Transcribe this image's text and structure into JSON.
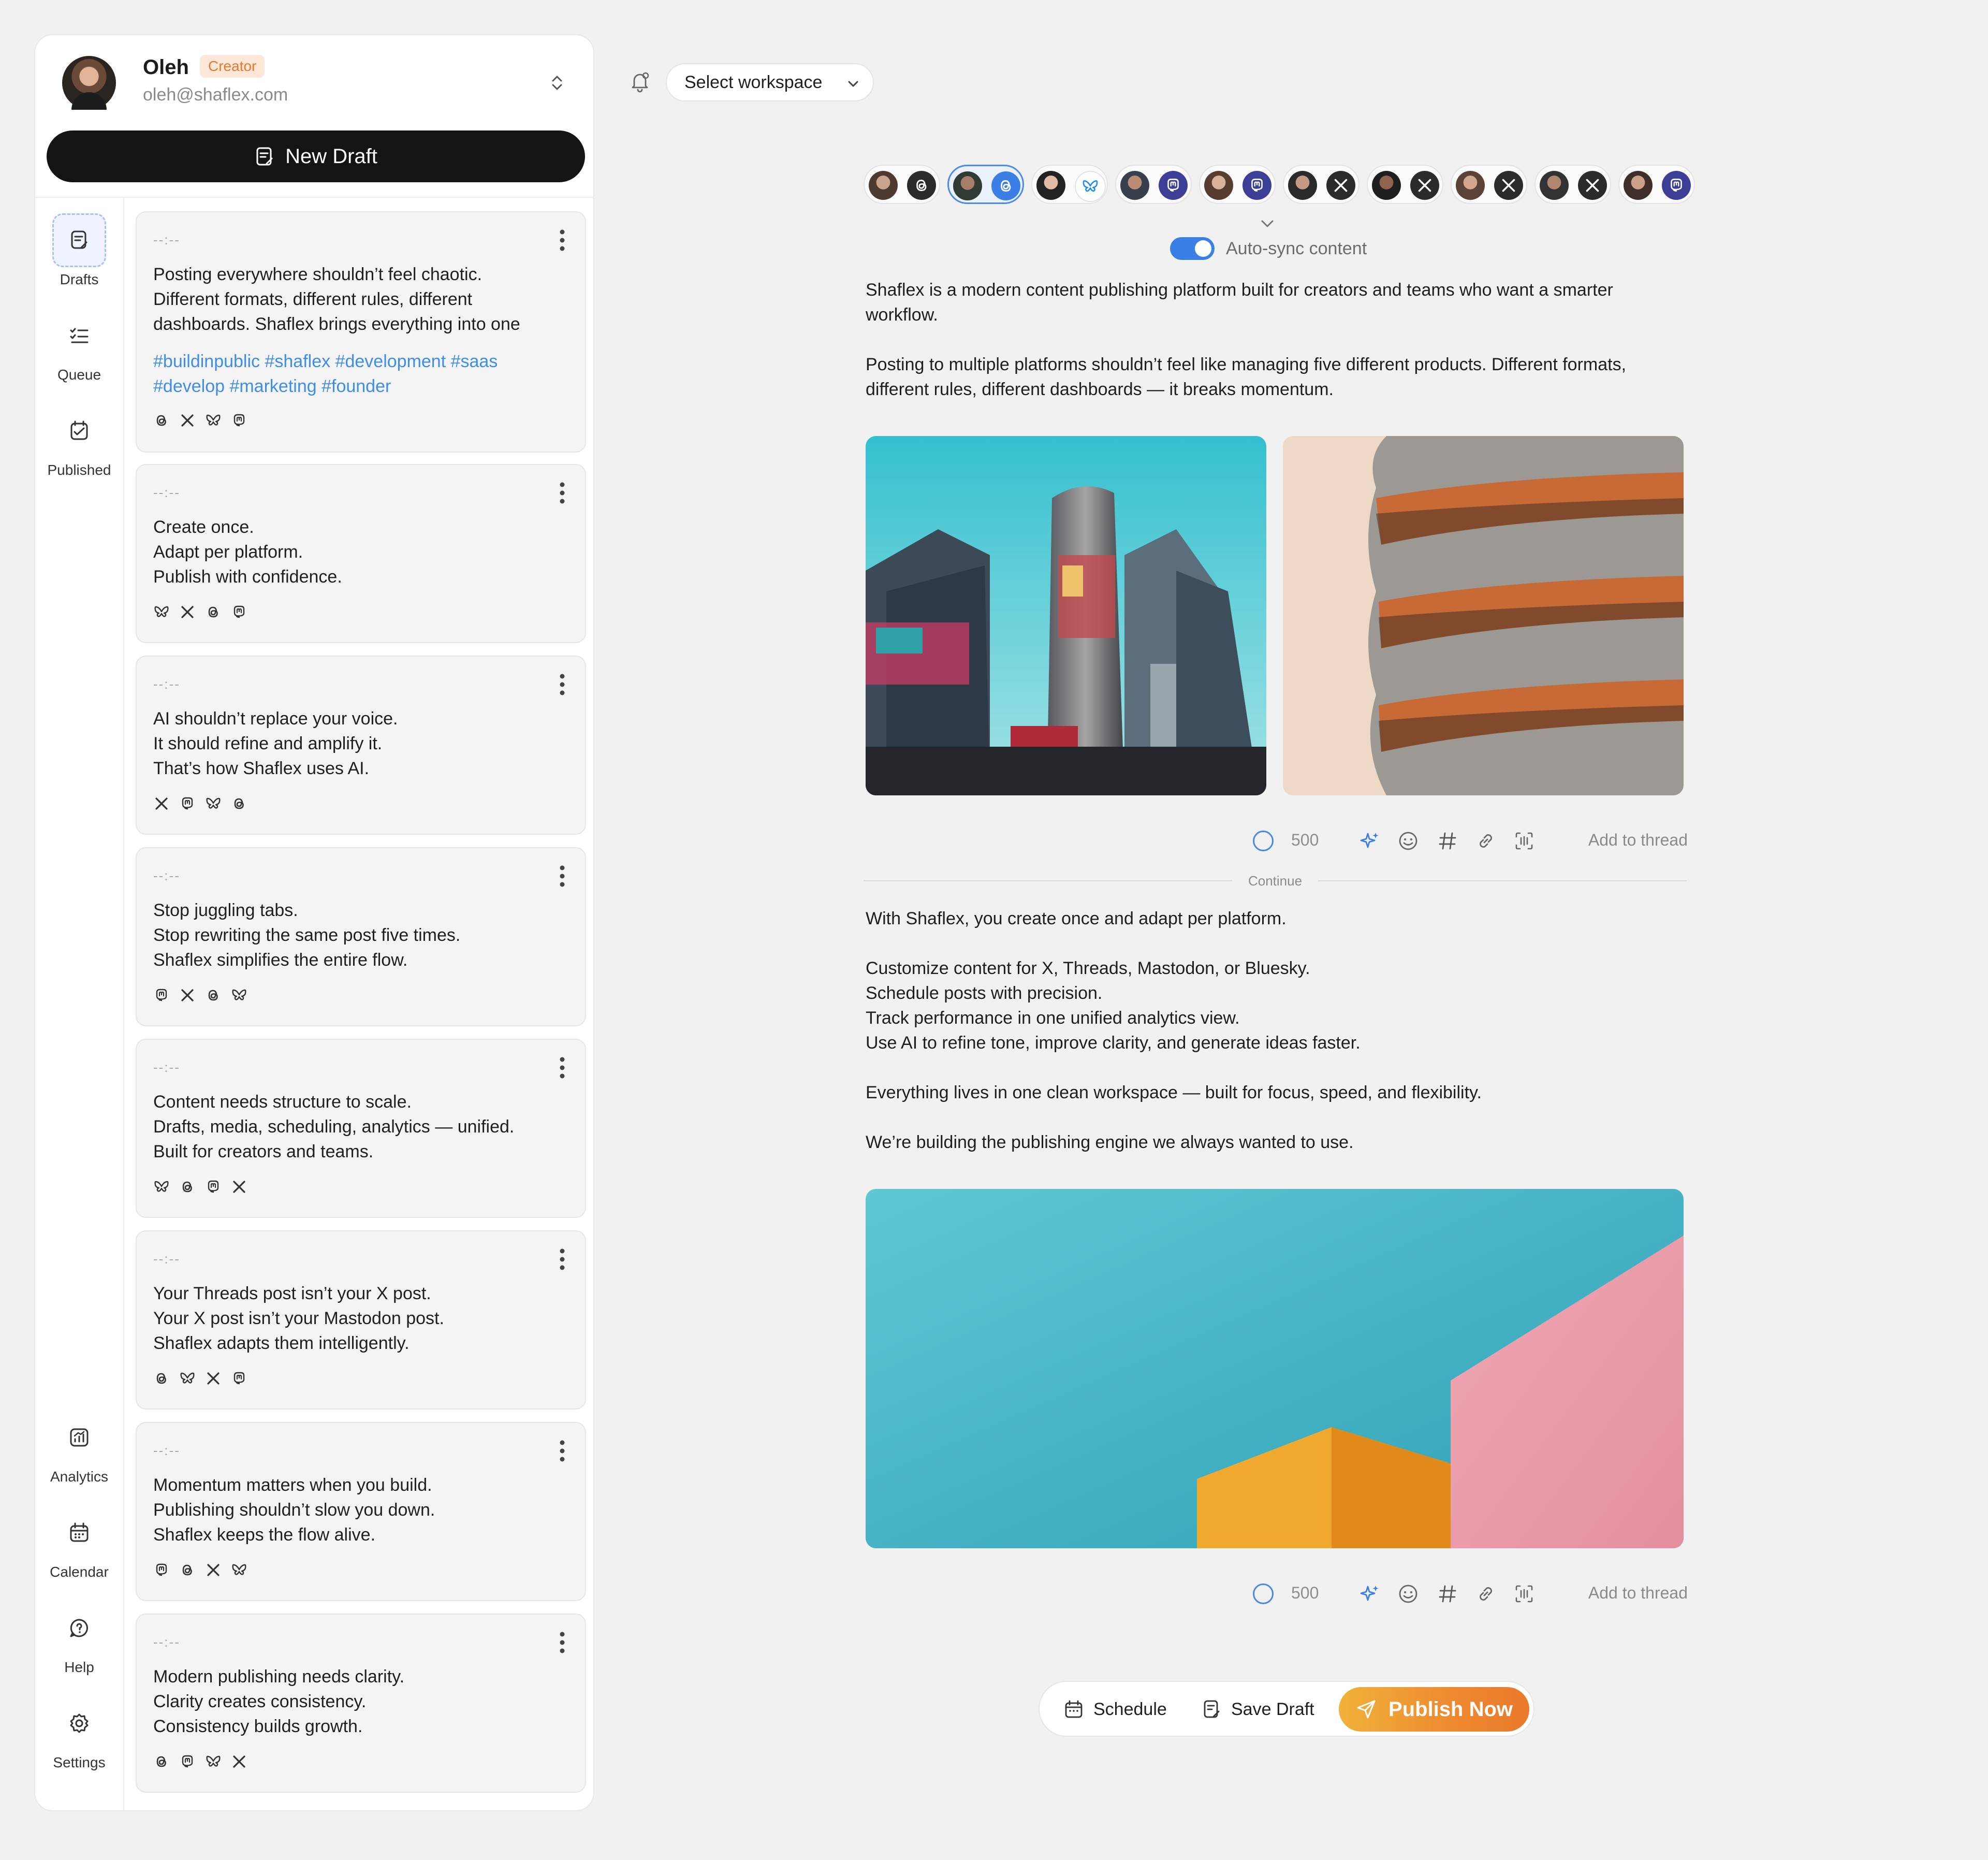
{
  "user": {
    "name": "Oleh",
    "badge": "Creator",
    "email": "oleh@shaflex.com"
  },
  "new_draft_label": "New Draft",
  "rail": {
    "top": [
      {
        "label": "Drafts",
        "icon": "drafts-icon"
      },
      {
        "label": "Queue",
        "icon": "queue-icon"
      },
      {
        "label": "Published",
        "icon": "published-icon"
      }
    ],
    "bottom": [
      {
        "label": "Analytics",
        "icon": "analytics-icon"
      },
      {
        "label": "Calendar",
        "icon": "calendar-icon"
      },
      {
        "label": "Help",
        "icon": "help-icon"
      },
      {
        "label": "Settings",
        "icon": "settings-icon"
      }
    ]
  },
  "drafts": [
    {
      "time": "--:--",
      "text": "Posting everywhere shouldn’t feel chaotic.\nDifferent formats, different rules, different\ndashboards. Shaflex brings everything into one",
      "tags": "#buildinpublic #shaflex #development #saas\n#develop #marketing #founder",
      "platforms": [
        "threads",
        "x",
        "bluesky",
        "mastodon"
      ]
    },
    {
      "time": "--:--",
      "text": "Create once.\nAdapt per platform.\nPublish with confidence.",
      "tags": "",
      "platforms": [
        "bluesky",
        "x",
        "threads",
        "mastodon"
      ]
    },
    {
      "time": "--:--",
      "text": "AI shouldn’t replace your voice.\nIt should refine and amplify it.\nThat’s how Shaflex uses AI.",
      "tags": "",
      "platforms": [
        "x",
        "mastodon",
        "bluesky",
        "threads"
      ]
    },
    {
      "time": "--:--",
      "text": "Stop juggling tabs.\nStop rewriting the same post five times.\nShaflex simplifies the entire flow.",
      "tags": "",
      "platforms": [
        "mastodon",
        "x",
        "threads",
        "bluesky"
      ]
    },
    {
      "time": "--:--",
      "text": "Content needs structure to scale.\nDrafts, media, scheduling, analytics — unified.\nBuilt for creators and teams.",
      "tags": "",
      "platforms": [
        "bluesky",
        "threads",
        "mastodon",
        "x"
      ]
    },
    {
      "time": "--:--",
      "text": "Your Threads post isn’t your X post.\nYour X post isn’t your Mastodon post.\nShaflex adapts them intelligently.",
      "tags": "",
      "platforms": [
        "threads",
        "bluesky",
        "x",
        "mastodon"
      ]
    },
    {
      "time": "--:--",
      "text": "Momentum matters when you build.\nPublishing shouldn’t slow you down.\nShaflex keeps the flow alive.",
      "tags": "",
      "platforms": [
        "mastodon",
        "threads",
        "x",
        "bluesky"
      ]
    },
    {
      "time": "--:--",
      "text": "Modern publishing needs clarity.\nClarity creates consistency.\nConsistency builds growth.",
      "tags": "",
      "platforms": [
        "threads",
        "mastodon",
        "bluesky",
        "x"
      ]
    }
  ],
  "workspace": {
    "label": "Select workspace"
  },
  "accounts": [
    {
      "platform": "threads",
      "selected": false
    },
    {
      "platform": "threads",
      "selected": true
    },
    {
      "platform": "bluesky",
      "selected": false
    },
    {
      "platform": "mastodon",
      "selected": false
    },
    {
      "platform": "mastodon",
      "selected": false
    },
    {
      "platform": "x",
      "selected": false
    },
    {
      "platform": "x",
      "selected": false
    },
    {
      "platform": "x",
      "selected": false
    },
    {
      "platform": "x",
      "selected": false
    },
    {
      "platform": "mastodon",
      "selected": false
    }
  ],
  "autosync": {
    "label": "Auto-sync content",
    "on": true
  },
  "post1": {
    "text": "Shaflex is a modern content publishing platform built for creators and teams who want a smarter\nworkflow.\n\nPosting to multiple platforms shouldn’t feel like managing five different products. Different formats,\ndifferent rules, different dashboards — it breaks momentum.",
    "char_count": "500",
    "add_thread": "Add to thread"
  },
  "continue_label": "Continue",
  "post2": {
    "text": "With Shaflex, you create once and adapt per platform.\n\nCustomize content for X, Threads, Mastodon, or Bluesky.\nSchedule posts with precision.\nTrack performance in one unified analytics view.\nUse AI to refine tone, improve clarity, and generate ideas faster.\n\nEverything lives in one clean workspace — built for focus, speed, and flexibility.\n\nWe’re building the publishing engine we always wanted to use.",
    "char_count": "500",
    "add_thread": "Add to thread"
  },
  "actions": {
    "schedule": "Schedule",
    "save_draft": "Save Draft",
    "publish_now": "Publish Now"
  },
  "colors": {
    "accent": "#3b7fe6",
    "badge": "#e57a2c",
    "publish_start": "#f0b23a",
    "publish_end": "#e97a2a",
    "hashtag": "#3e8ee9"
  }
}
